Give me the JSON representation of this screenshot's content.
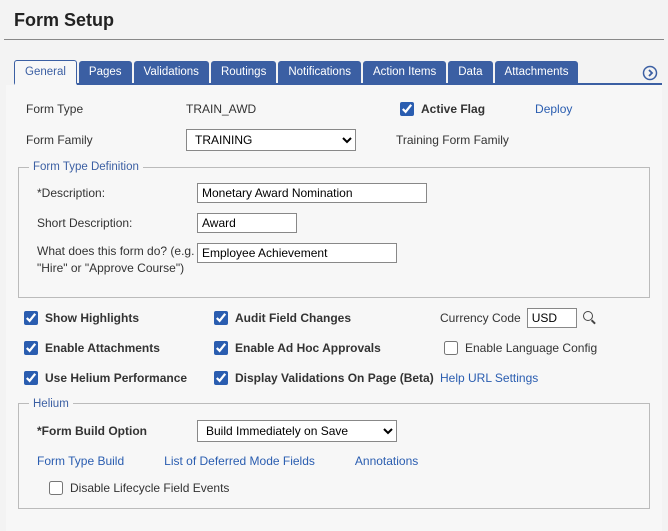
{
  "title": "Form Setup",
  "tabs": [
    "General",
    "Pages",
    "Validations",
    "Routings",
    "Notifications",
    "Action Items",
    "Data",
    "Attachments"
  ],
  "activeTab": 0,
  "formType": {
    "label": "Form Type",
    "value": "TRAIN_AWD"
  },
  "activeFlag": {
    "label": "Active Flag",
    "checked": true
  },
  "deployLink": "Deploy",
  "formFamily": {
    "label": "Form Family",
    "value": "TRAINING",
    "desc": "Training Form Family"
  },
  "definition": {
    "legend": "Form Type Definition",
    "descriptionLabel": "*Description:",
    "descriptionValue": "Monetary Award Nomination",
    "shortLabel": "Short Description:",
    "shortValue": "Award",
    "whatLabel": "What does this form do? (e.g. \"Hire\" or \"Approve Course\")",
    "whatValue": "Employee Achievement"
  },
  "checks": {
    "showHighlights": {
      "label": "Show Highlights",
      "checked": true
    },
    "auditFieldChanges": {
      "label": "Audit Field Changes",
      "checked": true
    },
    "currencyLabel": "Currency Code",
    "currencyValue": "USD",
    "enableAttachments": {
      "label": "Enable Attachments",
      "checked": true
    },
    "enableAdHoc": {
      "label": "Enable Ad Hoc Approvals",
      "checked": true
    },
    "enableLanguage": {
      "label": "Enable Language Config",
      "checked": false
    },
    "useHelium": {
      "label": "Use Helium Performance",
      "checked": true
    },
    "displayValidations": {
      "label": "Display Validations On Page (Beta)",
      "checked": true
    },
    "helpUrl": "Help URL Settings"
  },
  "helium": {
    "legend": "Helium",
    "buildOptionLabel": "*Form Build Option",
    "buildOptionValue": "Build Immediately on Save",
    "links": [
      "Form Type Build",
      "List of Deferred Mode Fields",
      "Annotations"
    ],
    "disableLifecycle": {
      "label": "Disable Lifecycle Field Events",
      "checked": false
    }
  }
}
